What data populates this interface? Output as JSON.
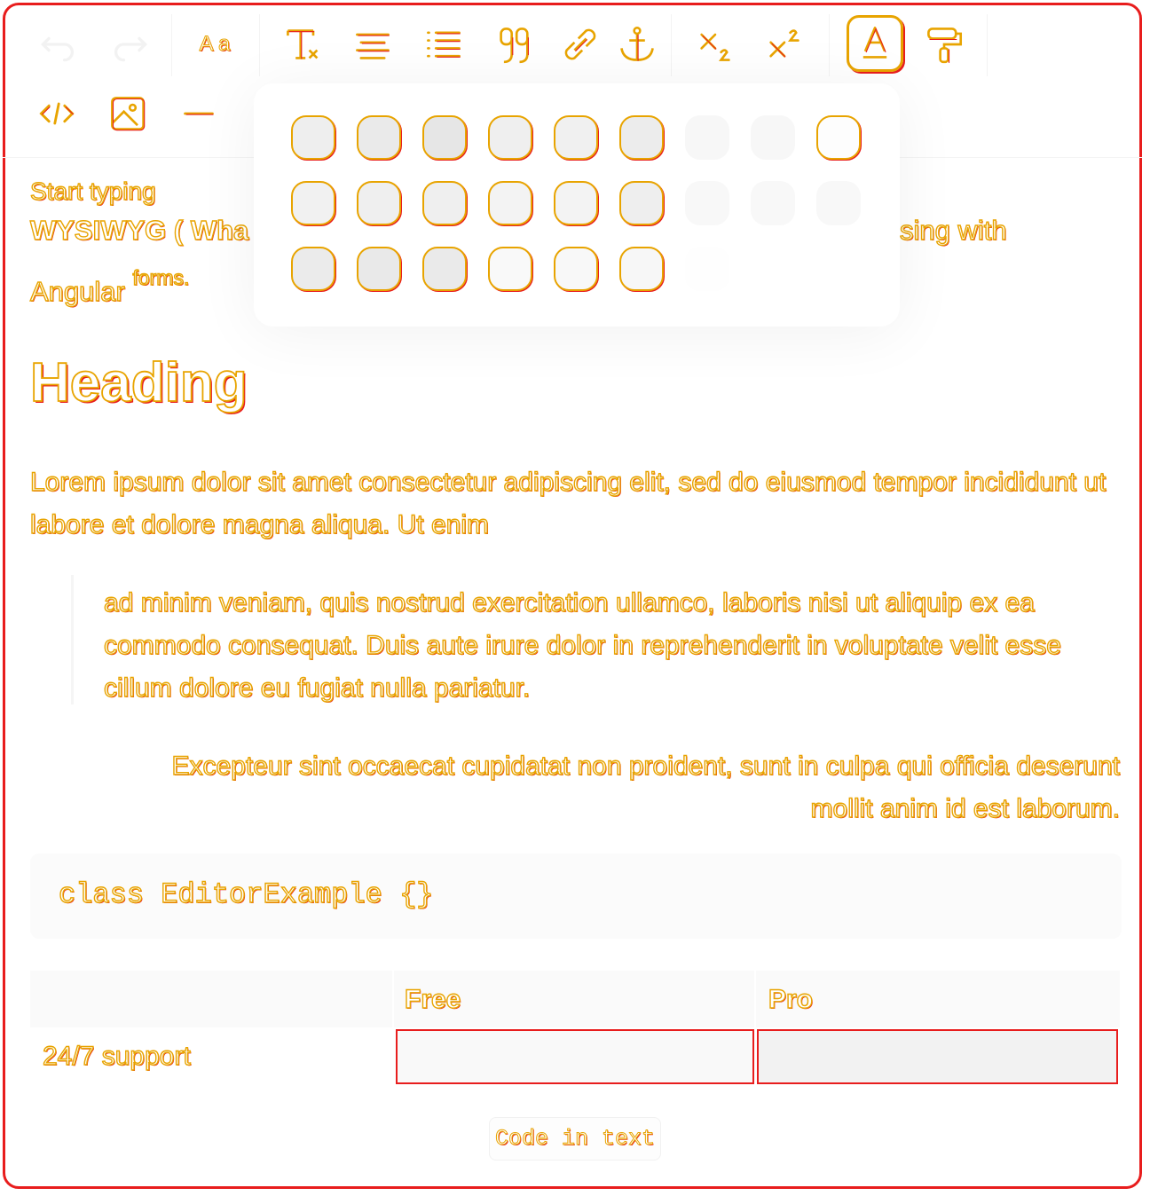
{
  "toolbar": {
    "row1": [
      {
        "name": "undo-icon",
        "enabled": false
      },
      {
        "name": "redo-icon",
        "enabled": false
      },
      {
        "name": "font-size-icon",
        "glyph": "A a"
      },
      {
        "name": "clear-formatting-icon"
      },
      {
        "name": "align-icon"
      },
      {
        "name": "list-icon"
      },
      {
        "name": "quote-icon"
      },
      {
        "name": "link-icon"
      },
      {
        "name": "anchor-icon"
      },
      {
        "name": "subscript-icon"
      },
      {
        "name": "superscript-icon"
      },
      {
        "name": "text-color-icon",
        "active": true
      },
      {
        "name": "paint-roller-icon"
      }
    ],
    "row2": [
      {
        "name": "code-icon"
      },
      {
        "name": "image-icon"
      },
      {
        "name": "horizontal-rule-icon"
      }
    ]
  },
  "palette": {
    "rows": [
      [
        "#eeeeee",
        "#eaeaea",
        "#e6e6e6",
        "#efefef",
        "#f0f0f0",
        "#ececec",
        "#f7f7f7",
        "#f7f7f7",
        "#fdfdfd"
      ],
      [
        "#f1f1f1",
        "#efefef",
        "#efefef",
        "#f3f3f3",
        "#f3f3f3",
        "#eeeeee",
        "#f8f8f8",
        "#f8f8f8",
        "#f8f8f8"
      ],
      [
        "#ebebeb",
        "#e9e9e9",
        "#eaeaea",
        "#f9f9f9",
        "#f8f8f8",
        "#f7f7f7",
        "#fefefe"
      ]
    ]
  },
  "content": {
    "intro_line1": "Start typing",
    "intro_line2_start": "WYSIWYG ( Wha",
    "intro_line2_end": "sing with",
    "intro_line3": "Angular",
    "intro_line3_sup": "forms.",
    "heading": "Heading",
    "paragraph": "Lorem ipsum dolor sit amet consectetur adipiscing elit, sed do eiusmod tempor incididunt ut labore et dolore magna aliqua. Ut enim",
    "blockquote": "ad minim veniam, quis nostrud exercitation ullamco, laboris nisi ut aliquip ex ea commodo consequat. Duis aute irure dolor in reprehenderit in voluptate velit esse cillum dolore eu fugiat nulla pariatur.",
    "right_aligned": "Excepteur sint occaecat cupidatat non proident, sunt in culpa qui officia deserunt mollit anim id est laborum.",
    "code_block": "class EditorExample {}",
    "table": {
      "headers": [
        "",
        "Free",
        "Pro"
      ],
      "rows": [
        [
          "24/7 support",
          "",
          ""
        ]
      ]
    },
    "inline_code": "Code in text"
  },
  "colors": {
    "outline_yellow": "#e8a400",
    "outline_red": "#e81d1d"
  }
}
